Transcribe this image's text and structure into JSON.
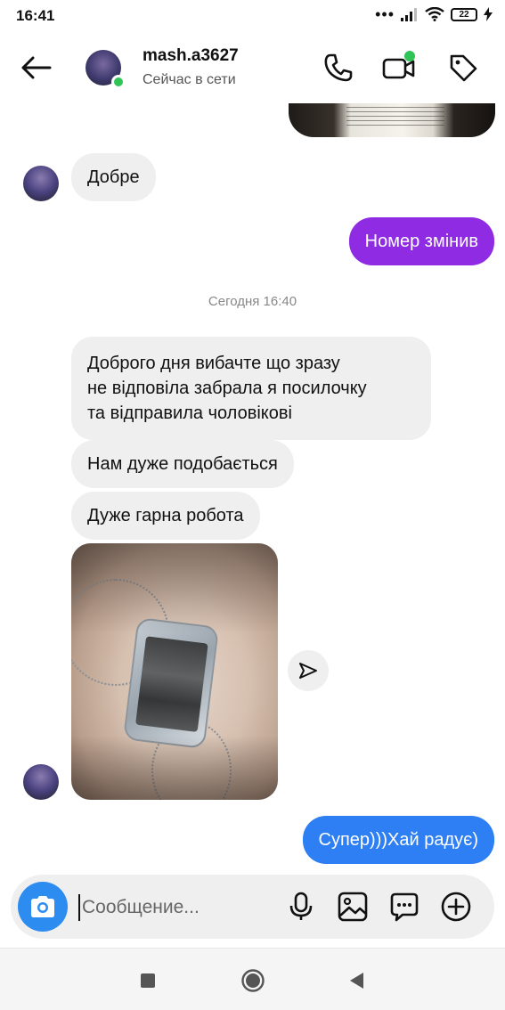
{
  "status_bar": {
    "time": "16:41",
    "battery": "22"
  },
  "header": {
    "username": "mash.a3627",
    "presence": "Сейчас в сети"
  },
  "messages": {
    "m1": "Добре",
    "m2": "Номер змінив",
    "timestamp": "Сегодня 16:40",
    "m3_line1": "Доброго дня  вибачте що зразу",
    "m3_line2": "не відповіла забрала я посилочку",
    "m3_line3": "та відправила чоловікові",
    "m4": "Нам дуже подобається",
    "m5": "Дуже гарна робота",
    "m6": "Супер)))Хай радує)"
  },
  "composer": {
    "placeholder": "Сообщение..."
  },
  "icons": {
    "back": "arrow-left-icon",
    "call": "phone-icon",
    "video": "video-camera-icon",
    "tag": "tag-icon",
    "share": "send-icon",
    "camera": "camera-icon",
    "mic": "microphone-icon",
    "gallery": "image-icon",
    "sticker": "chat-bubble-icon",
    "plus": "plus-circle-icon"
  },
  "colors": {
    "outgoing_purple": "#8e2be3",
    "outgoing_blue": "#2d7ff3",
    "incoming_gray": "#efefef",
    "online_green": "#2fc455",
    "camera_blue": "#2d8cf0"
  }
}
